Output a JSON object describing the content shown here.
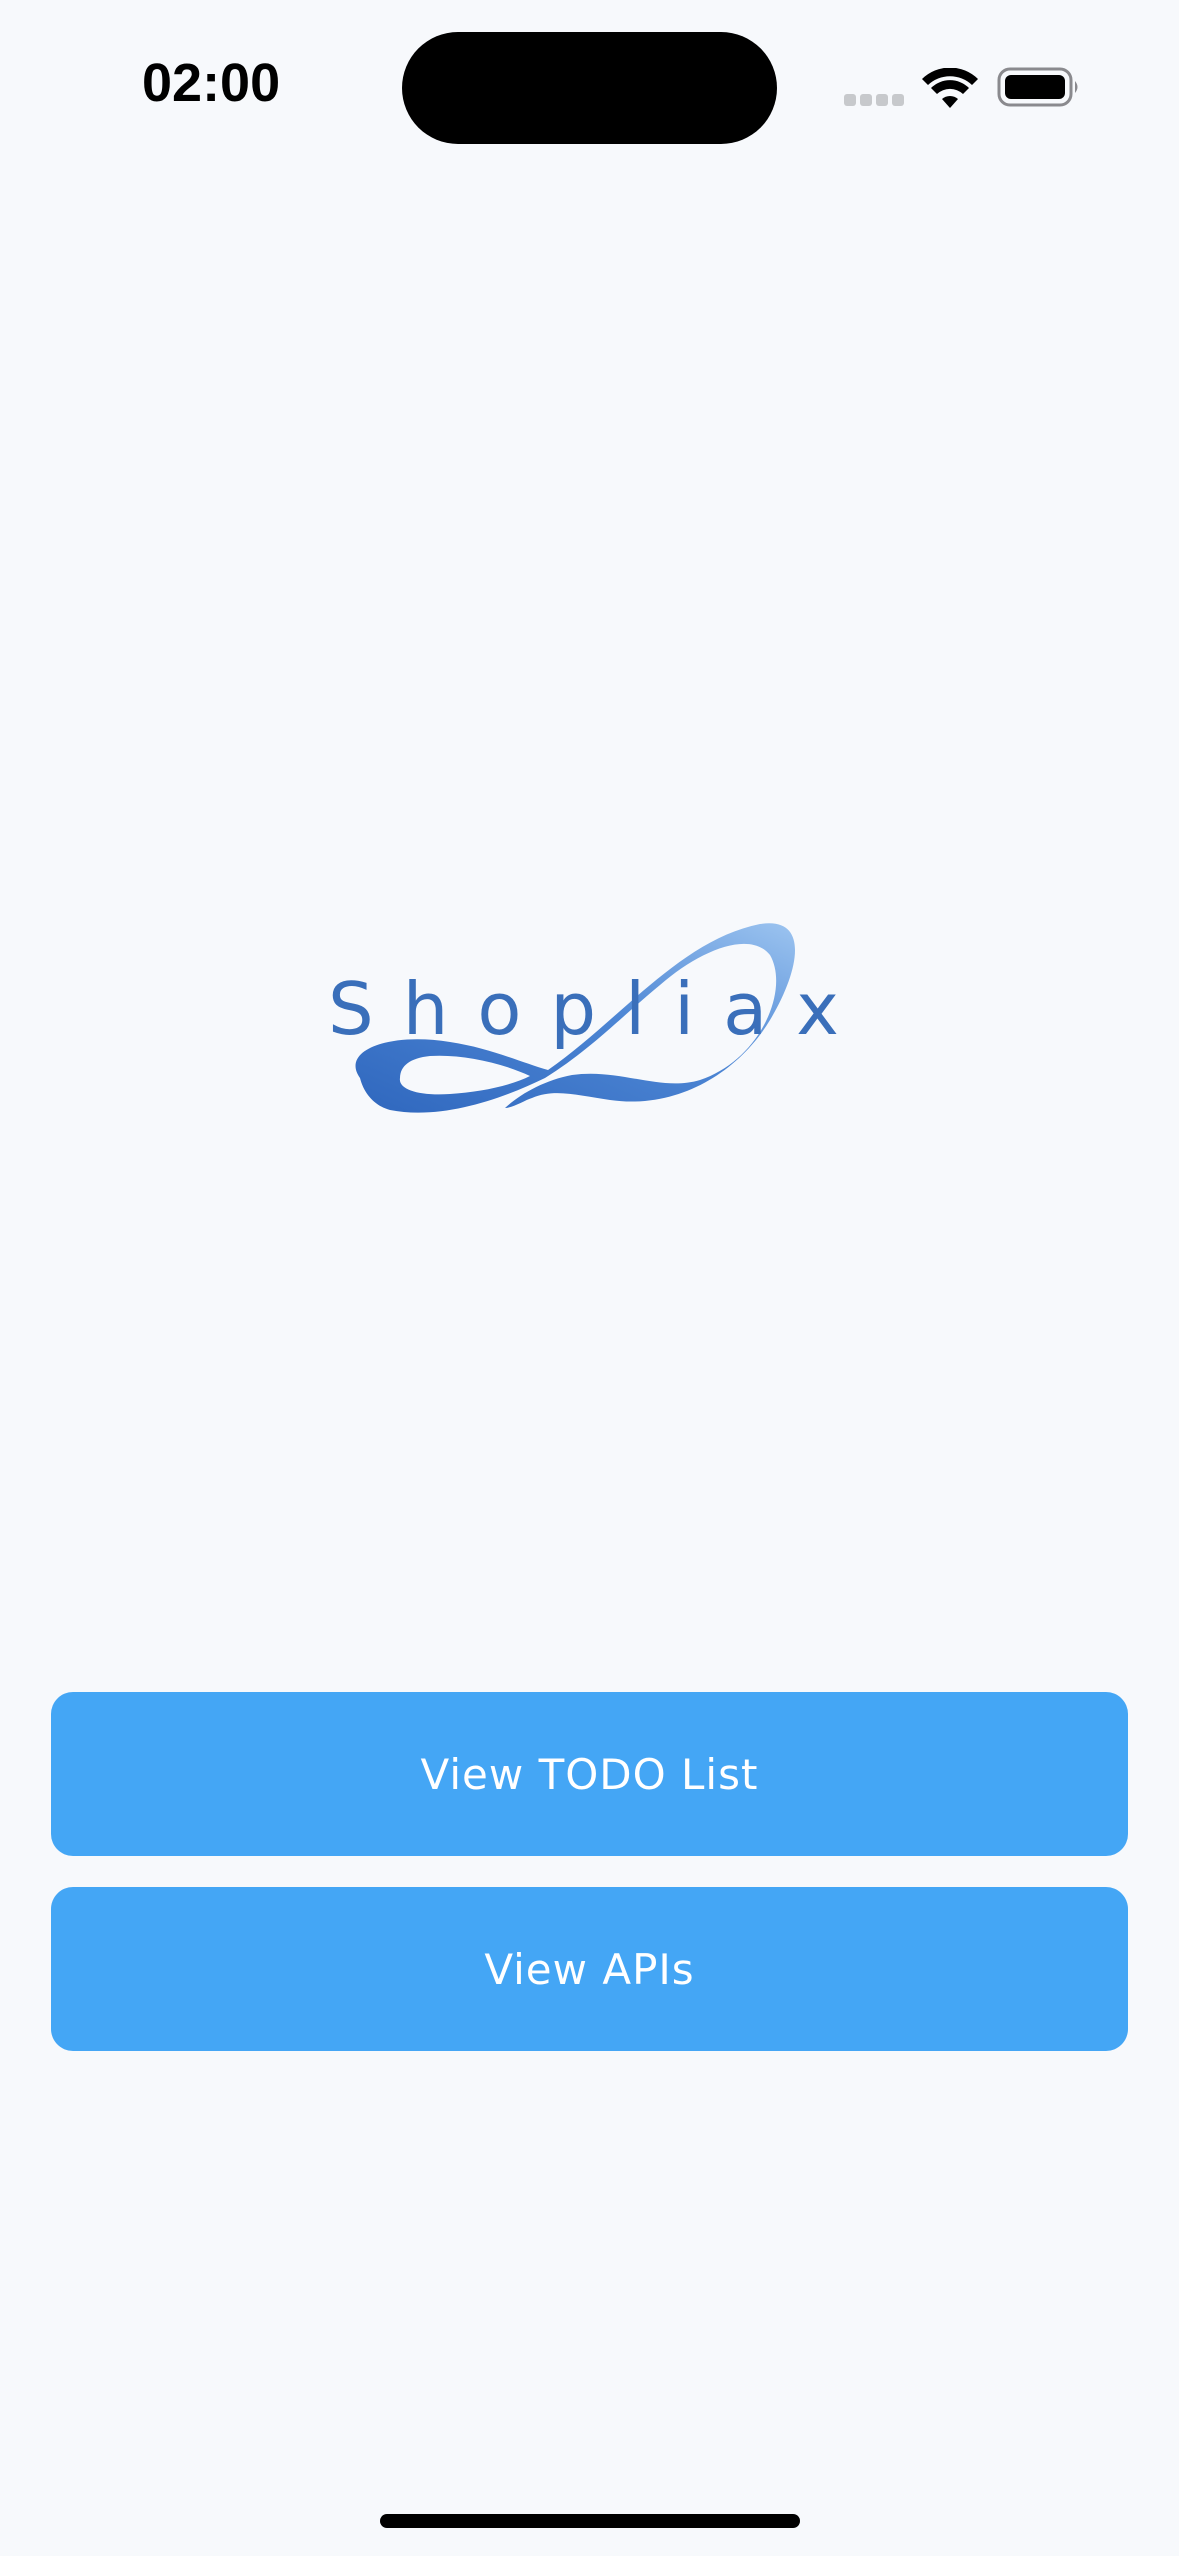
{
  "status_bar": {
    "time": "02:00"
  },
  "logo": {
    "text": "Shopliax",
    "colors": {
      "text": "#3a6fba",
      "swoosh_dark": "#2f67be",
      "swoosh_light": "#8ebbee"
    }
  },
  "buttons": {
    "todo_label": "View TODO List",
    "apis_label": "View APIs",
    "color": "#44a6f5"
  }
}
